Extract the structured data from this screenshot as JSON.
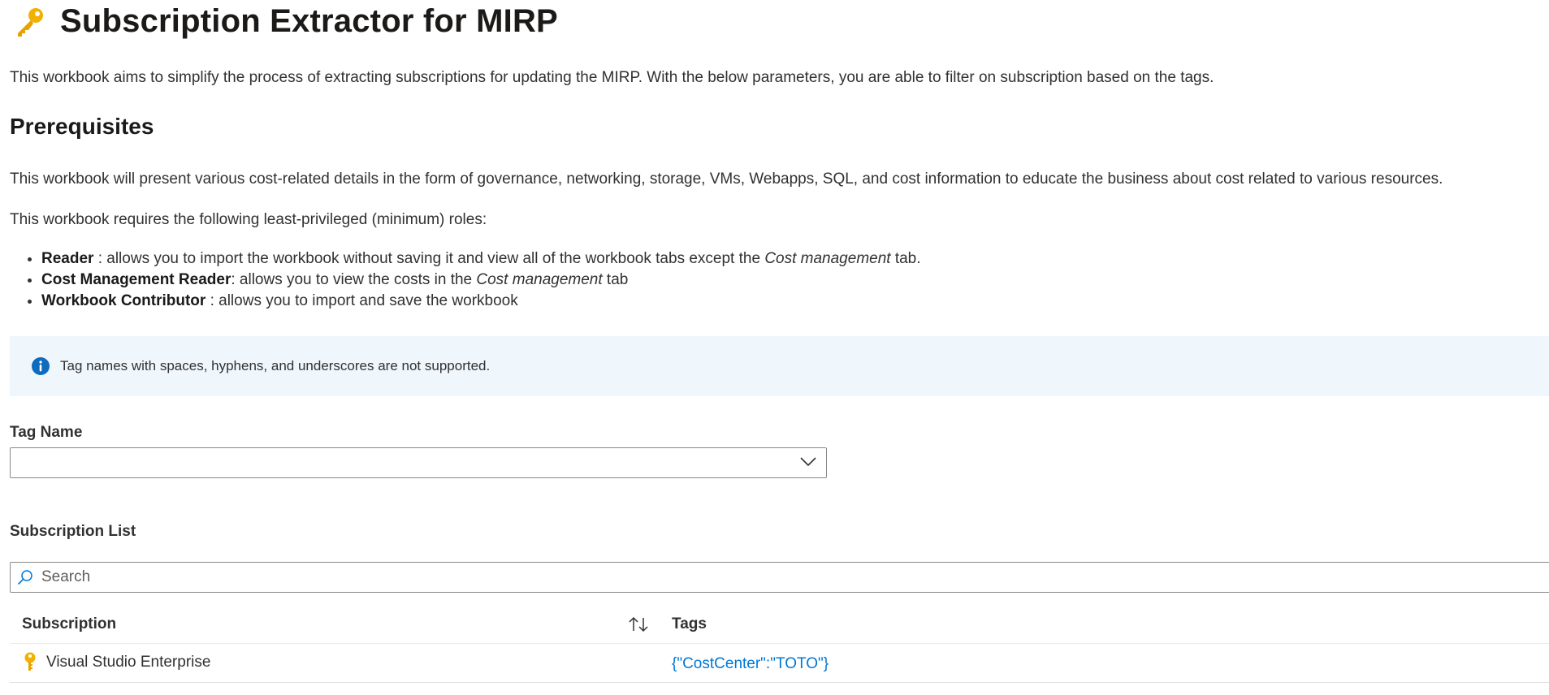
{
  "header": {
    "title": "Subscription Extractor for MIRP",
    "icon": "key-icon",
    "icon_color": "#f2b100"
  },
  "intro_text": "This workbook aims to simplify the process of extracting subscriptions for updating the MIRP. With the below parameters, you are able to filter on subscription based on the tags.",
  "prerequisites": {
    "heading": "Prerequisites",
    "paragraph1": "This workbook will present various cost-related details in the form of governance, networking, storage, VMs, Webapps, SQL, and cost information to educate the business about cost related to various resources.",
    "paragraph2": "This workbook requires the following least-privileged (minimum) roles:",
    "roles": [
      {
        "name": "Reader",
        "sep": " : ",
        "text_before": "allows you to import the workbook without saving it and view all of the workbook tabs except the ",
        "emphasis": "Cost management",
        "text_after": " tab."
      },
      {
        "name": "Cost Management Reader",
        "sep": ": ",
        "text_before": "allows you to view the costs in the ",
        "emphasis": "Cost management",
        "text_after": " tab"
      },
      {
        "name": "Workbook Contributor",
        "sep": " : ",
        "text_before": "allows you to import and save the workbook",
        "emphasis": "",
        "text_after": ""
      }
    ]
  },
  "info_banner": {
    "icon": "info-icon",
    "icon_color": "#0f6cbd",
    "background": "#eff6fc",
    "text": "Tag names with spaces, hyphens, and underscores are not supported."
  },
  "tag_name": {
    "label": "Tag Name",
    "value": ""
  },
  "subscription_list": {
    "label": "Subscription List",
    "search_placeholder": "Search",
    "columns": {
      "subscription": "Subscription",
      "tags": "Tags"
    },
    "rows": [
      {
        "subscription": "Visual Studio Enterprise",
        "tags": "{\"CostCenter\":\"TOTO\"}"
      }
    ],
    "link_color": "#0078d4"
  }
}
